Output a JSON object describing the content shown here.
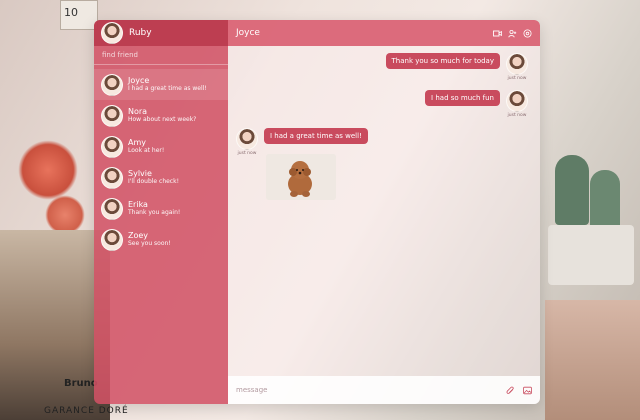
{
  "background": {
    "frame_number": "10",
    "book_spine": "Bruno",
    "book_cover": "GARANCE DORÉ"
  },
  "sidebar": {
    "current_user": "Ruby",
    "search_placeholder": "find friend",
    "contacts": [
      {
        "name": "Joyce",
        "preview": "I had a great time as well!"
      },
      {
        "name": "Nora",
        "preview": "How about next week?"
      },
      {
        "name": "Amy",
        "preview": "Look at her!"
      },
      {
        "name": "Sylvie",
        "preview": "I'll double check!"
      },
      {
        "name": "Erika",
        "preview": "Thank you again!"
      },
      {
        "name": "Zoey",
        "preview": "See you soon!"
      }
    ]
  },
  "chat": {
    "title": "Joyce",
    "header_icons": [
      "video-icon",
      "add-user-icon",
      "settings-icon"
    ],
    "messages": [
      {
        "from": "me",
        "text": "Thank you so much for today",
        "time": "just now"
      },
      {
        "from": "me",
        "text": "I had so much fun",
        "time": "just now"
      },
      {
        "from": "them",
        "text": "I had a great time as well!",
        "time": "just now"
      },
      {
        "from": "them",
        "type": "image",
        "alt": "poodle-puppy-photo"
      }
    ],
    "composer": {
      "placeholder": "message",
      "icons": [
        "attach-icon",
        "image-icon"
      ]
    }
  },
  "colors": {
    "accent": "#d25064",
    "bubble": "#c94b5e"
  }
}
